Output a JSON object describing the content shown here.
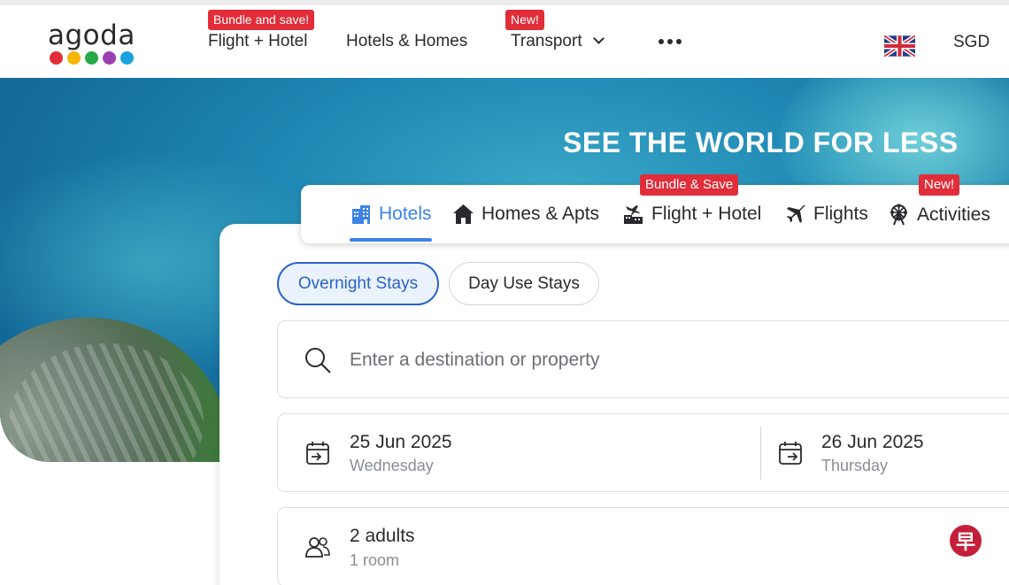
{
  "header": {
    "logo_text": "agoda",
    "logo_dot_colors": [
      "#e12d39",
      "#f4b400",
      "#29a849",
      "#9c3fb3",
      "#1aa3dc"
    ],
    "nav": [
      {
        "label": "Flight + Hotel",
        "badge": "Bundle and save!"
      },
      {
        "label": "Hotels & Homes",
        "badge": ""
      },
      {
        "label": "Transport",
        "badge": "New!"
      }
    ],
    "more_icon": "ellipsis-icon",
    "flag_icon": "uk-flag-icon",
    "currency": "SGD"
  },
  "hero": {
    "title": "SEE THE WORLD FOR LESS"
  },
  "tabs": {
    "items": [
      {
        "label": "Hotels",
        "icon": "hotel-icon",
        "active": true,
        "badge": ""
      },
      {
        "label": "Homes & Apts",
        "icon": "home-icon",
        "active": false,
        "badge": ""
      },
      {
        "label": "Flight + Hotel",
        "icon": "flight-hotel-icon",
        "active": false,
        "badge": "Bundle & Save"
      },
      {
        "label": "Flights",
        "icon": "plane-icon",
        "active": false,
        "badge": ""
      },
      {
        "label": "Activities",
        "icon": "ferris-wheel-icon",
        "active": false,
        "badge": "New!"
      }
    ]
  },
  "search": {
    "stay_types": {
      "overnight": "Overnight Stays",
      "day_use": "Day Use Stays",
      "selected": "Overnight Stays"
    },
    "destination_placeholder": "Enter a destination or property",
    "check_in": {
      "date": "25 Jun 2025",
      "day": "Wednesday"
    },
    "check_out": {
      "date": "26 Jun 2025",
      "day": "Thursday"
    },
    "guests": {
      "adults": "2 adults",
      "rooms": "1 room"
    }
  },
  "colors": {
    "accent_blue": "#3c83e5",
    "badge_red": "#e12d39",
    "pill_border": "#2a63c8"
  },
  "corner_badge": "早"
}
